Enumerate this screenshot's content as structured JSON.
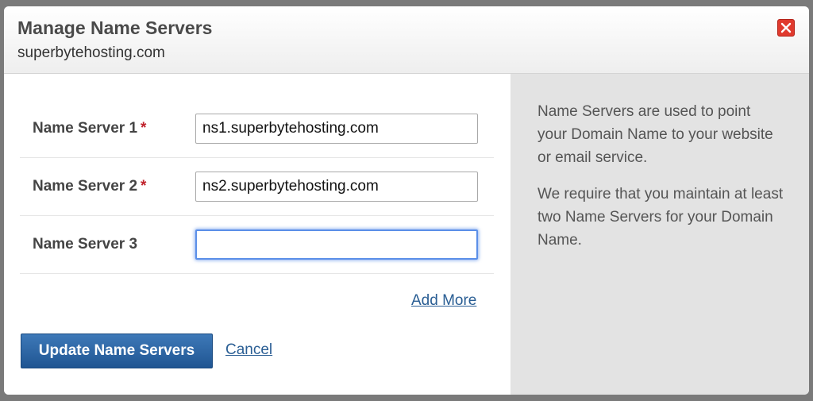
{
  "dialog": {
    "title": "Manage Name Servers",
    "domain": "superbytehosting.com"
  },
  "form": {
    "required_marker": "*",
    "rows": [
      {
        "label": "Name Server 1",
        "required": true,
        "value": "ns1.superbytehosting.com"
      },
      {
        "label": "Name Server 2",
        "required": true,
        "value": "ns2.superbytehosting.com"
      },
      {
        "label": "Name Server 3",
        "required": false,
        "value": ""
      }
    ],
    "add_more_label": "Add More",
    "submit_label": "Update Name Servers",
    "cancel_label": "Cancel"
  },
  "help": {
    "paragraph_1": "Name Servers are used to point your Domain Name to your website or email service.",
    "paragraph_2": "We require that you maintain at least two Name Servers for your Domain Name."
  },
  "icons": {
    "close": "close-icon"
  },
  "colors": {
    "primary_button": "#2a62a3",
    "link": "#2a5e94",
    "required": "#c0222c",
    "close_button": "#e03a2e",
    "focus_ring": "#5b8fe8",
    "help_panel_bg": "#e3e3e3"
  }
}
